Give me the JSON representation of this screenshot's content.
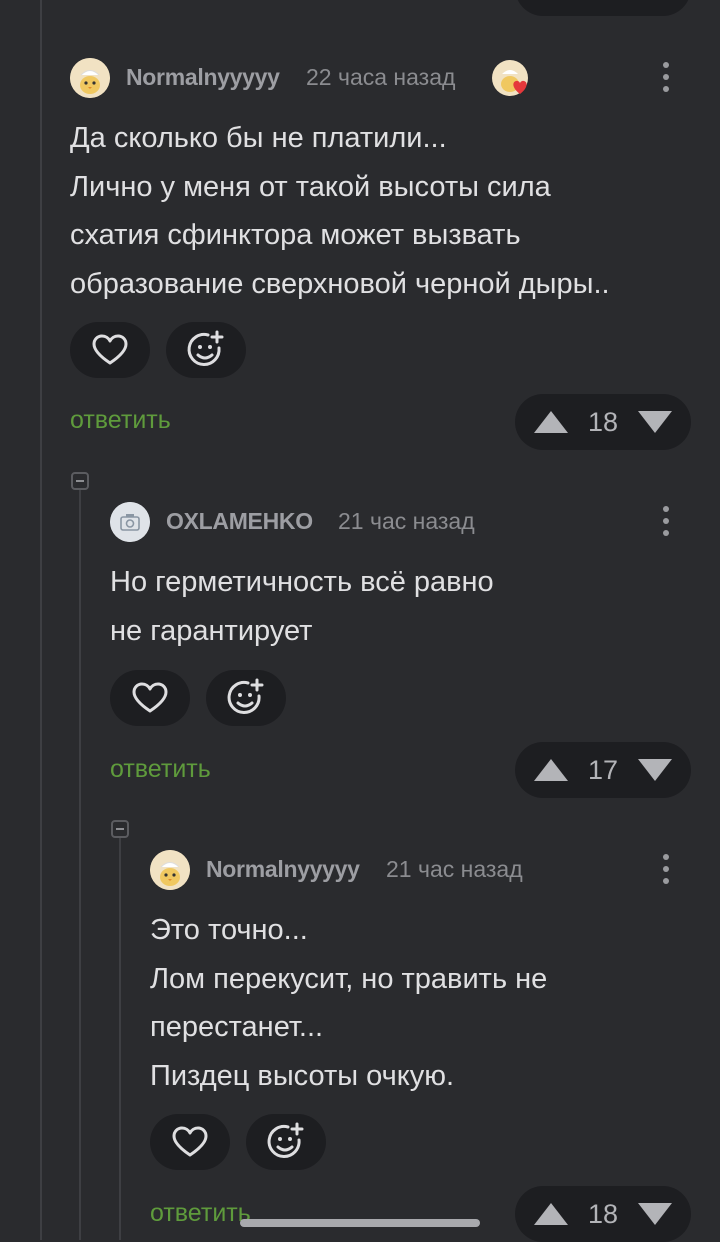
{
  "comments": [
    {
      "author": "Normalnyyyyy",
      "time": "22 часа назад",
      "lines": [
        "Да сколько бы не платили...",
        "Лично у меня от такой высоты сила",
        "схатия сфинктора может вызвать",
        "образование сверхновой черной дыры.."
      ],
      "reply_label": "ответить",
      "rating": "18"
    },
    {
      "author": "OXLAMEHKO",
      "time": "21 час назад",
      "lines": [
        "Но герметичность всё равно",
        "не гарантирует"
      ],
      "reply_label": "ответить",
      "rating": "17"
    },
    {
      "author": "Normalnyyyyy",
      "time": "21 час назад",
      "lines": [
        "Это точно...",
        "Лом перекусит, но травить не",
        "перестанет...",
        "Пиздец высоты очкую."
      ],
      "reply_label": "ответить",
      "rating": "18"
    }
  ],
  "colors": {
    "background": "#2a2b2e",
    "pill": "#1d1e21",
    "reply_link": "#5f9b3c",
    "badge_heart": "#e5383b"
  },
  "icons": [
    "heart-outline-icon",
    "add-emoji-icon",
    "arrow-up-icon",
    "arrow-down-icon",
    "more-vertical-icon",
    "heart-badge-icon",
    "camera-avatar-icon"
  ]
}
